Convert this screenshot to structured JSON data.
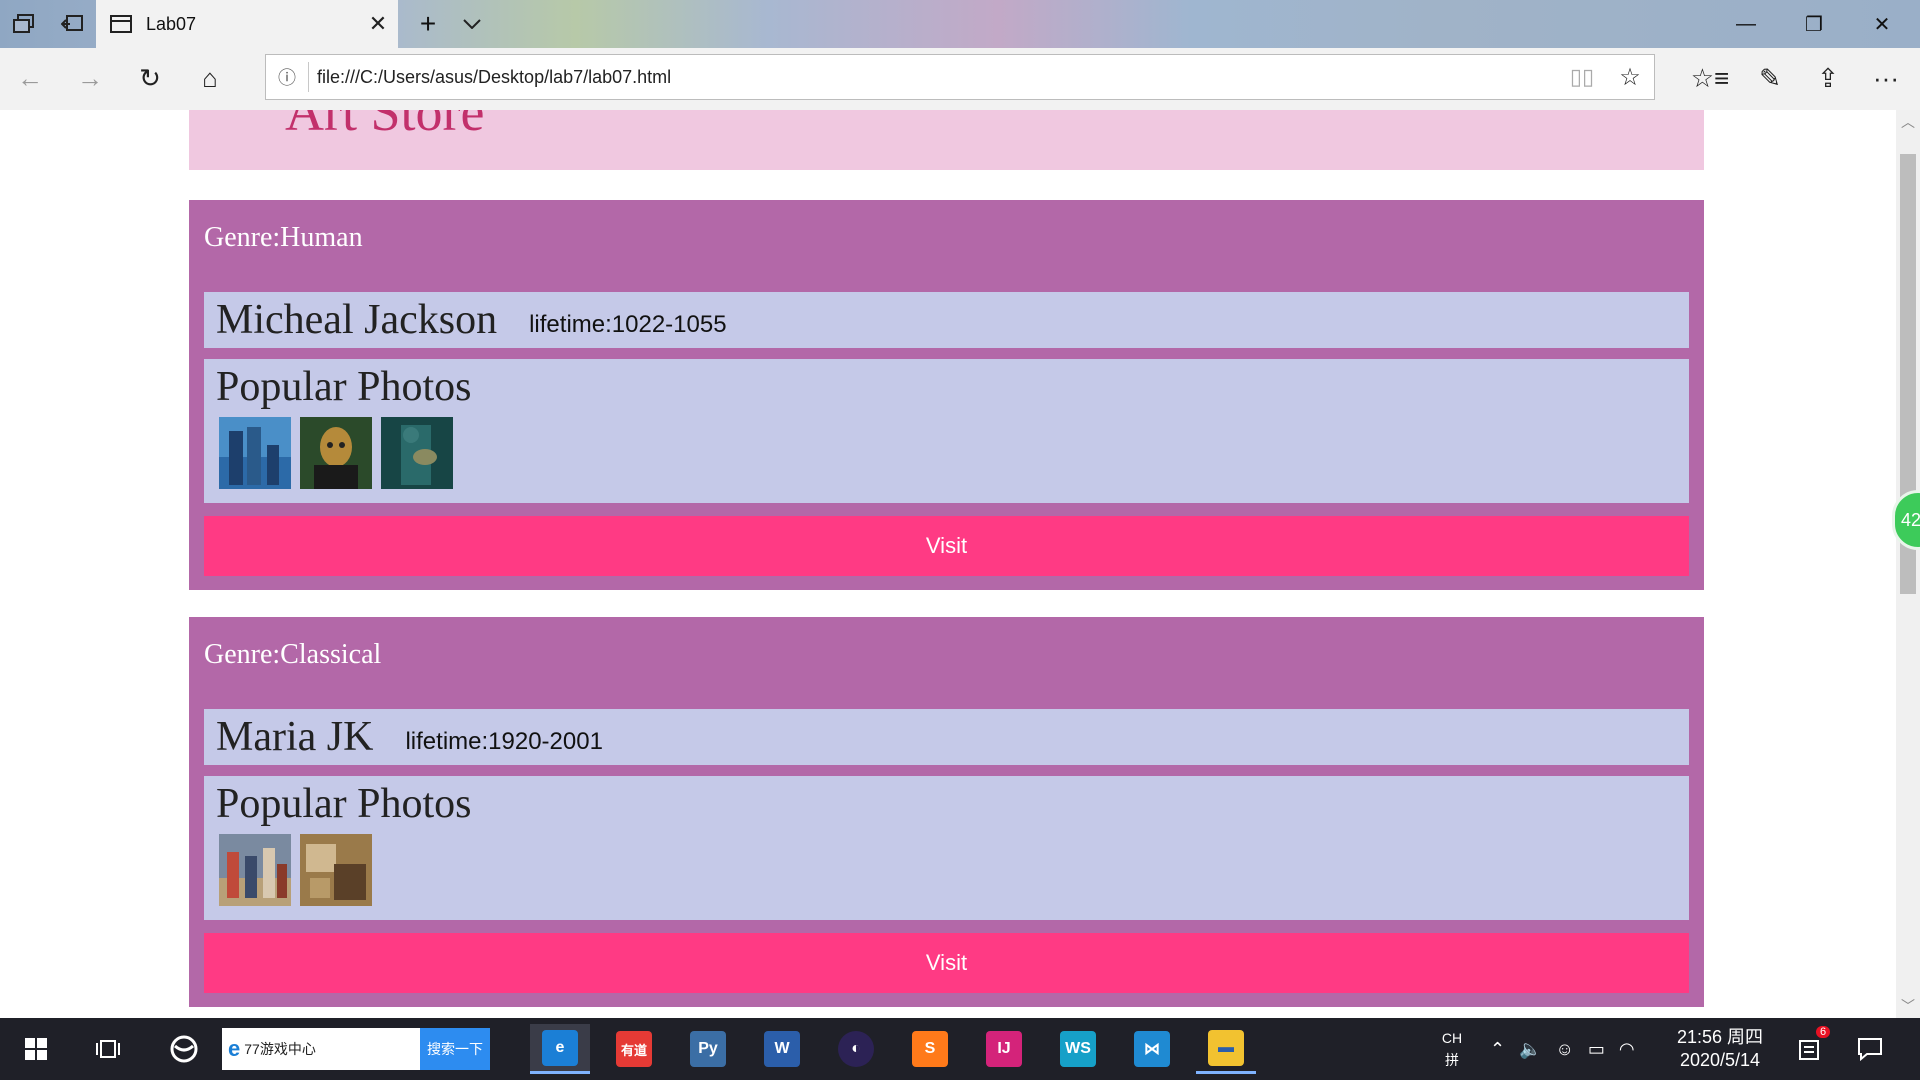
{
  "browser": {
    "tab_title": "Lab07",
    "url": "file:///C:/Users/asus/Desktop/lab7/lab07.html",
    "icons": {
      "tab_preview": "tab-preview-icon",
      "set_aside": "set-aside-icon",
      "close": "✕",
      "new_tab": "+",
      "tab_list": "⌵",
      "minimize": "—",
      "restore": "❐",
      "win_close": "✕",
      "back": "←",
      "forward": "→",
      "refresh": "↻",
      "home": "⌂",
      "info": "ⓘ",
      "reader": "▯▯",
      "favorite": "☆",
      "favorites_hub": "☆≡",
      "notes": "✎",
      "share": "⇪",
      "more": "···"
    }
  },
  "page": {
    "site_title": "Art Store",
    "genres": [
      {
        "title": "Genre:Human",
        "artist": "Micheal Jackson",
        "lifetime": "lifetime:1022-1055",
        "photos_heading": "Popular Photos",
        "photos": [
          {
            "name": "painting-1",
            "colors": [
              "#2c6aa8",
              "#4a8fc8",
              "#1d3f6c"
            ]
          },
          {
            "name": "painting-2",
            "colors": [
              "#b58a3a",
              "#2b4a2a",
              "#1a1a1a"
            ]
          },
          {
            "name": "painting-3",
            "colors": [
              "#2a6a6a",
              "#174545",
              "#8a8a60"
            ]
          }
        ],
        "visit_label": "Visit"
      },
      {
        "title": "Genre:Classical",
        "artist": "Maria JK",
        "lifetime": "lifetime:1920-2001",
        "photos_heading": "Popular Photos",
        "photos": [
          {
            "name": "painting-4",
            "colors": [
              "#7a8aa0",
              "#b8a078",
              "#c04a3a"
            ]
          },
          {
            "name": "painting-5",
            "colors": [
              "#9a7a4a",
              "#d0b890",
              "#5a4028"
            ]
          }
        ],
        "visit_label": "Visit"
      }
    ]
  },
  "float_badge": "42",
  "taskbar": {
    "search_text": "77游戏中心",
    "search_button": "搜索一下",
    "apps": [
      {
        "name": "edge",
        "label": "e",
        "color": "#1b7fd6"
      },
      {
        "name": "youdao",
        "label": "有道",
        "color": "#e53a35"
      },
      {
        "name": "python",
        "label": "Py",
        "color": "#3b6ea5"
      },
      {
        "name": "word",
        "label": "W",
        "color": "#2b5eaa"
      },
      {
        "name": "eclipse",
        "label": "◐",
        "color": "#2c2255"
      },
      {
        "name": "sublime",
        "label": "S",
        "color": "#ff7a1a"
      },
      {
        "name": "intellij",
        "label": "IJ",
        "color": "#d4237a"
      },
      {
        "name": "webstorm",
        "label": "WS",
        "color": "#16a0c8"
      },
      {
        "name": "vscode",
        "label": "⋈",
        "color": "#1f8ad2"
      },
      {
        "name": "explorer",
        "label": "▬",
        "color": "#f2c230"
      }
    ],
    "ime_top": "CH",
    "ime_bottom": "拼",
    "time": "21:56 周四",
    "date": "2020/5/14",
    "notification_count": "6"
  },
  "colors": {
    "header_band": "#f0c8e0",
    "genre_bg": "#b368a8",
    "row_bg": "#c5c9e8",
    "visit_bg": "#ff3a84",
    "title_text": "#c2306b"
  }
}
